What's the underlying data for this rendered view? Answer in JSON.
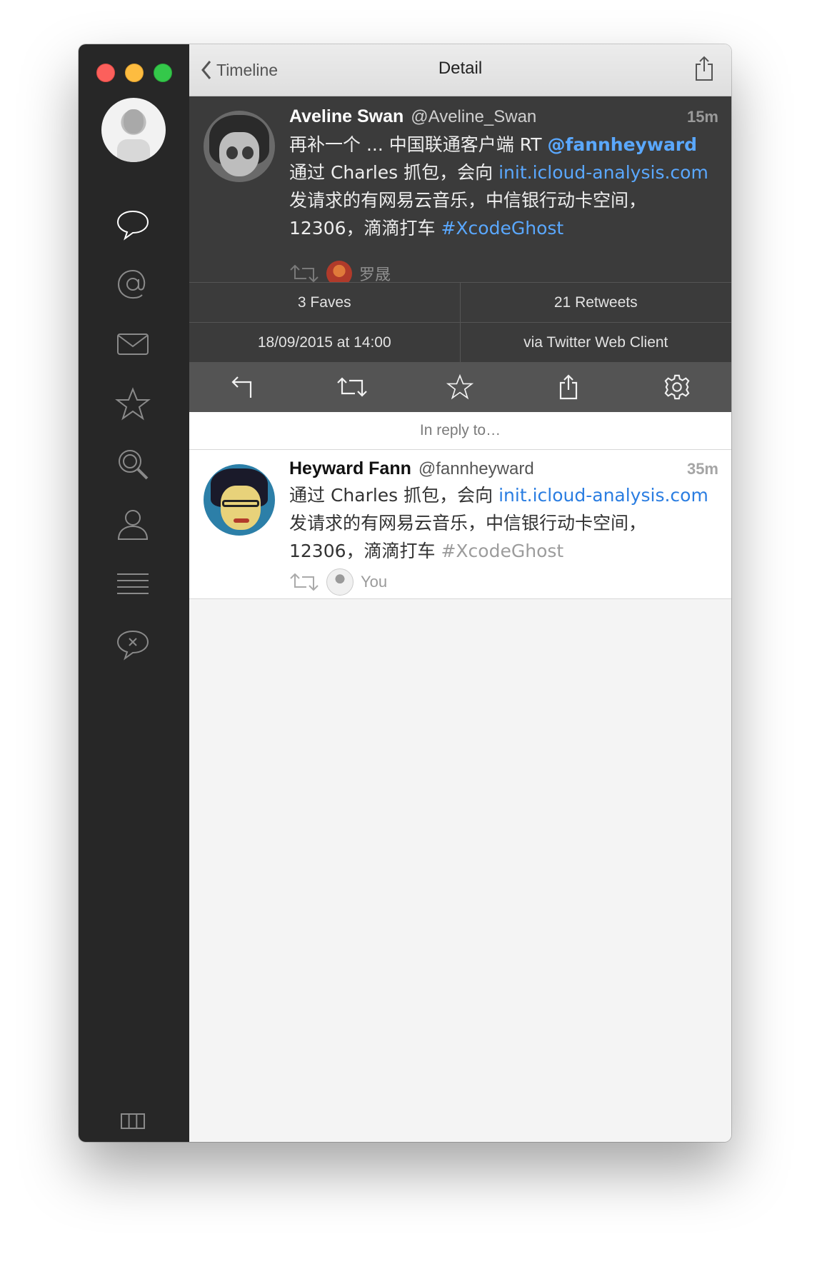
{
  "window": {
    "title": "Detail",
    "back_label": "Timeline"
  },
  "sidebar": {
    "items": [
      {
        "icon": "speech-bubble-icon",
        "active": true
      },
      {
        "icon": "at-sign-icon"
      },
      {
        "icon": "envelope-icon"
      },
      {
        "icon": "star-icon"
      },
      {
        "icon": "search-icon"
      },
      {
        "icon": "person-icon"
      },
      {
        "icon": "list-icon"
      },
      {
        "icon": "muted-bubble-icon"
      }
    ],
    "footer_icon": "columns-icon"
  },
  "detail_tweet": {
    "name": "Aveline Swan",
    "handle": "@Aveline_Swan",
    "time": "15m",
    "text_prefix": "再补一个 ... 中国联通客户端 RT ",
    "mention": "@fannheyward",
    "text_mid": " 通过 Charles 抓包，会向 ",
    "link": "init.icloud-analysis.com",
    "text_after_link": " 发请求的有网易云音乐，中信银行动卡空间，12306，滴滴打车 ",
    "hashtag": "#XcodeGhost",
    "retweeted_by": "罗晟"
  },
  "stats": {
    "faves": "3 Faves",
    "retweets": "21 Retweets",
    "date": "18/09/2015 at 14:00",
    "via": "via Twitter Web Client"
  },
  "actions": [
    "reply-icon",
    "retweet-icon",
    "star-icon",
    "share-icon",
    "gear-icon"
  ],
  "reply_header": "In reply to…",
  "reply_tweet": {
    "name": "Heyward Fann",
    "handle": "@fannheyward",
    "time": "35m",
    "text_prefix": "通过 Charles 抓包，会向 ",
    "link": "init.icloud-analysis.com",
    "text_after_link": " 发请求的有网易云音乐，中信银行动卡空间，12306，滴滴打车 ",
    "hashtag": "#XcodeGhost",
    "retweeted_by": "You"
  },
  "colors": {
    "sidebar_bg": "#272727",
    "dark_tweet_bg": "#3b3b3b",
    "action_bar_bg": "#545454",
    "link_dark": "#5aa8ff",
    "link_light": "#2a7de1"
  }
}
